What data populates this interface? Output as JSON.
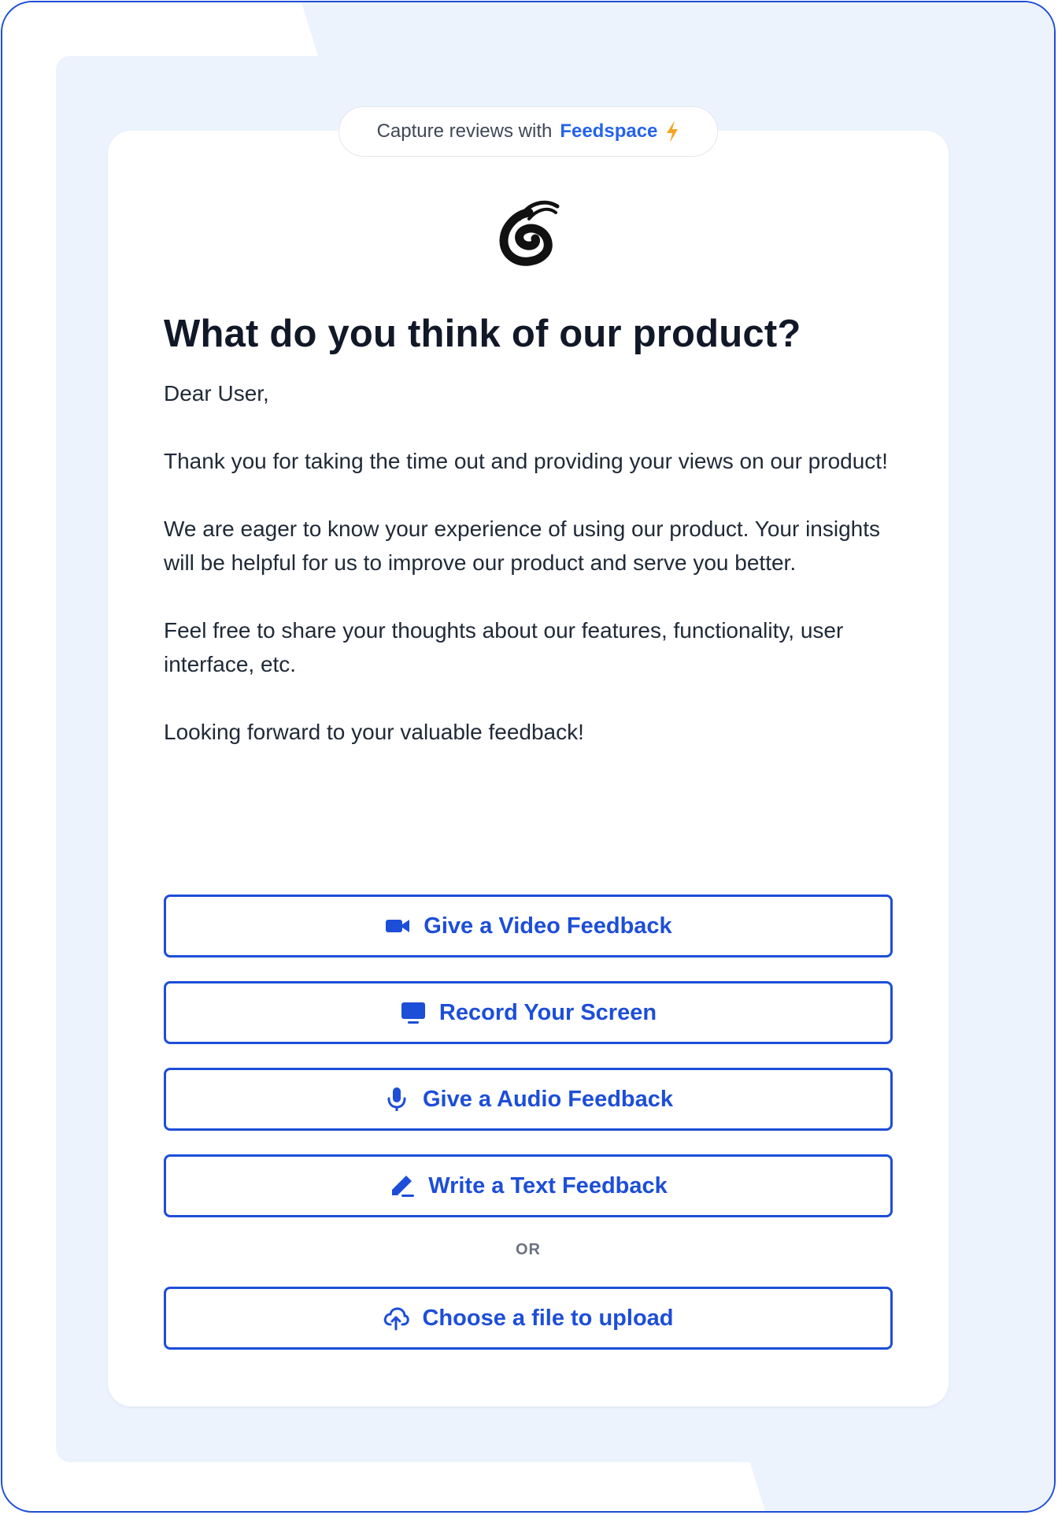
{
  "badge": {
    "prefix": "Capture reviews with",
    "brand": "Feedspace"
  },
  "colors": {
    "accent": "#1d4ed8",
    "brand_link": "#2563eb",
    "bolt": "#f5a524",
    "panel": "#edf3fd"
  },
  "logo": {
    "icon": "squiggle-logo-icon"
  },
  "heading": "What do you think of our product?",
  "message": {
    "greeting": "Dear User,",
    "p1": "Thank you for taking the time out and providing your views on our product!",
    "p2": "We are eager to know your experience of using our product. Your insights will be helpful for us to improve our product and serve you better.",
    "p3": "Feel free to share your thoughts about our features, functionality, user interface, etc.",
    "p4": "Looking forward to your valuable feedback!"
  },
  "buttons": [
    {
      "label": "Give a Video Feedback",
      "icon": "video-camera-icon"
    },
    {
      "label": "Record Your Screen",
      "icon": "monitor-icon"
    },
    {
      "label": "Give a Audio Feedback",
      "icon": "microphone-icon"
    },
    {
      "label": "Write a Text Feedback",
      "icon": "pencil-icon"
    }
  ],
  "divider_text": "OR",
  "upload": {
    "label": "Choose a file to upload",
    "icon": "cloud-upload-icon"
  }
}
